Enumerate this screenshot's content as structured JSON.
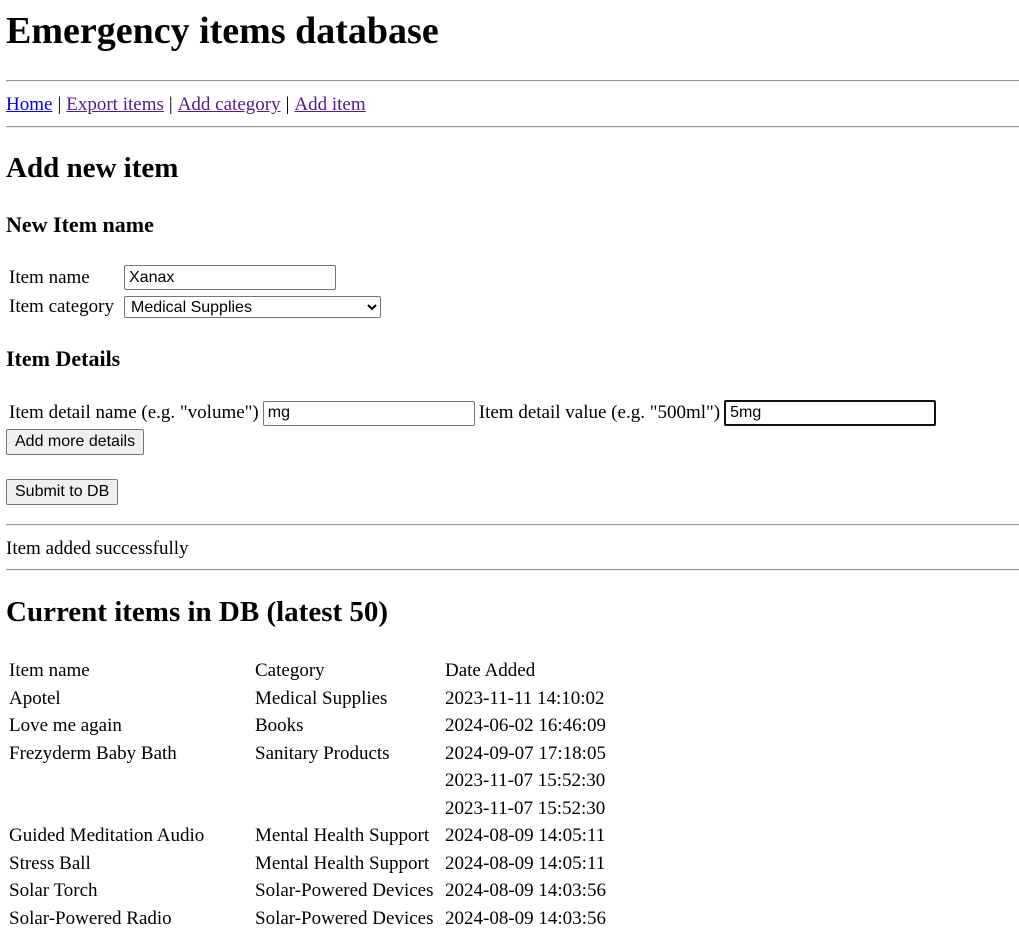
{
  "page": {
    "title": "Emergency items database"
  },
  "nav": {
    "home": "Home",
    "export": "Export items",
    "add_category": "Add category",
    "add_item": "Add item",
    "separator": "|"
  },
  "form": {
    "heading": "Add new item",
    "name_section": "New Item name",
    "item_name_label": "Item name",
    "item_name_value": "Xanax",
    "item_category_label": "Item category",
    "item_category_value": "Medical Supplies",
    "details_section": "Item Details",
    "detail_name_label": "Item detail name (e.g. \"volume\")",
    "detail_name_value": "mg",
    "detail_value_label": "Item detail value (e.g. \"500ml\")",
    "detail_value_value": "5mg",
    "add_more_button": "Add more details",
    "submit_button": "Submit to DB"
  },
  "status": {
    "message": "Item added successfully"
  },
  "items": {
    "heading": "Current items in DB (latest 50)",
    "columns": [
      "Item name",
      "Category",
      "Date Added"
    ],
    "rows": [
      [
        "Apotel",
        "Medical Supplies",
        "2023-11-11 14:10:02"
      ],
      [
        "Love me again",
        "Books",
        "2024-06-02 16:46:09"
      ],
      [
        "Frezyderm Baby Bath",
        "Sanitary Products",
        "2024-09-07 17:18:05"
      ],
      [
        "",
        "",
        "2023-11-07 15:52:30"
      ],
      [
        "",
        "",
        "2023-11-07 15:52:30"
      ],
      [
        "Guided Meditation Audio",
        "Mental Health Support",
        "2024-08-09 14:05:11"
      ],
      [
        "Stress Ball",
        "Mental Health Support",
        "2024-08-09 14:05:11"
      ],
      [
        "Solar Torch",
        "Solar-Powered Devices",
        "2024-08-09 14:03:56"
      ],
      [
        "Solar-Powered Radio",
        "Solar-Powered Devices",
        "2024-08-09 14:03:56"
      ]
    ]
  }
}
